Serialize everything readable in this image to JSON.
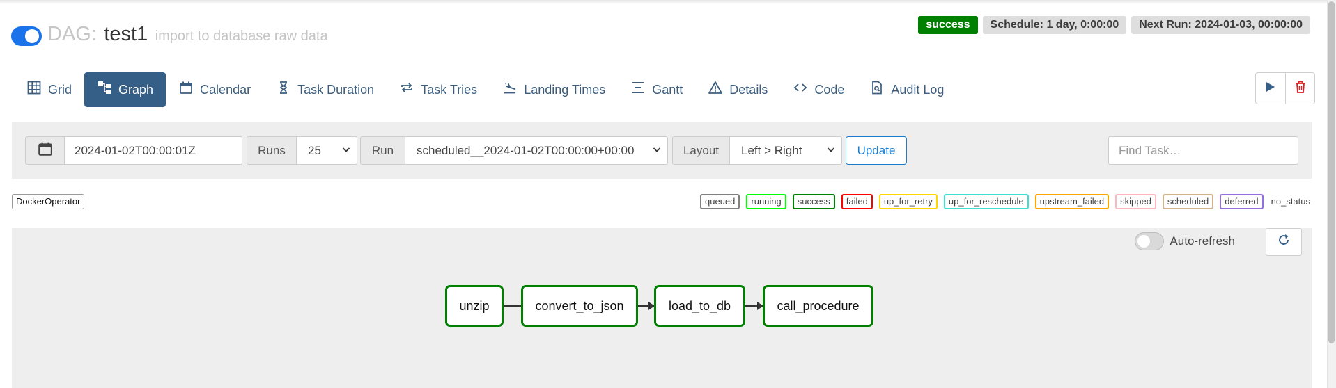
{
  "header": {
    "dag_prefix": "DAG:",
    "dag_name": "test1",
    "dag_description": "import to database raw data",
    "status": "success",
    "schedule": "Schedule: 1 day, 0:00:00",
    "next_run": "Next Run: 2024-01-03, 00:00:00"
  },
  "tabs": [
    {
      "label": "Grid",
      "icon": "grid-icon"
    },
    {
      "label": "Graph",
      "icon": "graph-icon"
    },
    {
      "label": "Calendar",
      "icon": "calendar-icon"
    },
    {
      "label": "Task Duration",
      "icon": "hourglass-icon"
    },
    {
      "label": "Task Tries",
      "icon": "repeat-icon"
    },
    {
      "label": "Landing Times",
      "icon": "plane-landing-icon"
    },
    {
      "label": "Gantt",
      "icon": "gantt-icon"
    },
    {
      "label": "Details",
      "icon": "warning-triangle-icon"
    },
    {
      "label": "Code",
      "icon": "code-icon"
    },
    {
      "label": "Audit Log",
      "icon": "file-search-icon"
    }
  ],
  "active_tab": "Graph",
  "filters": {
    "date_value": "2024-01-02T00:00:01Z",
    "runs_label": "Runs",
    "runs_value": "25",
    "run_label": "Run",
    "run_value": "scheduled__2024-01-02T00:00:00+00:00",
    "layout_label": "Layout",
    "layout_value": "Left > Right",
    "update_label": "Update",
    "find_placeholder": "Find Task…"
  },
  "operator": "DockerOperator",
  "legend": [
    {
      "label": "queued",
      "color": "#808080"
    },
    {
      "label": "running",
      "color": "#00ff00"
    },
    {
      "label": "success",
      "color": "#008000"
    },
    {
      "label": "failed",
      "color": "#ff0000"
    },
    {
      "label": "up_for_retry",
      "color": "#ffd700"
    },
    {
      "label": "up_for_reschedule",
      "color": "#40e0d0"
    },
    {
      "label": "upstream_failed",
      "color": "#ffa500"
    },
    {
      "label": "skipped",
      "color": "#ff69b4"
    },
    {
      "label": "scheduled",
      "color": "#d2b48c"
    },
    {
      "label": "deferred",
      "color": "#9370db"
    },
    {
      "label": "no_status",
      "color": ""
    }
  ],
  "graph": {
    "auto_refresh_label": "Auto-refresh",
    "nodes": [
      "unzip",
      "convert_to_json",
      "load_to_db",
      "call_procedure"
    ],
    "node_status_color": "#008000"
  }
}
